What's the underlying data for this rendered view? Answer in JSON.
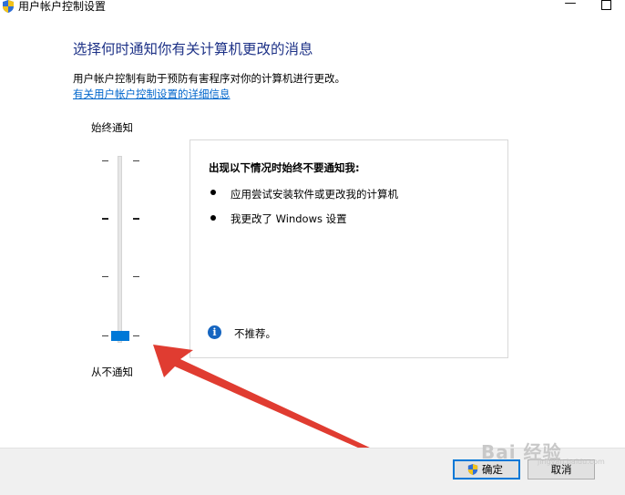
{
  "window": {
    "title": "用户帐户控制设置",
    "minimize_glyph": "—",
    "icon": "uac-shield-icon"
  },
  "main": {
    "heading": "选择何时通知你有关计算机更改的消息",
    "description": "用户帐户控制有助于预防有害程序对你的计算机进行更改。",
    "help_link": "有关用户帐户控制设置的详细信息"
  },
  "slider": {
    "top_label": "始终通知",
    "bottom_label": "从不通知",
    "levels": 4,
    "selected_level": 1,
    "thumb_color": "#0078d7"
  },
  "panel": {
    "heading": "出现以下情况时始终不要通知我:",
    "bullets": [
      "应用尝试安装软件或更改我的计算机",
      "我更改了 Windows 设置"
    ],
    "info_glyph": "i",
    "info_text": "不推荐。"
  },
  "buttons": {
    "ok": "确定",
    "cancel": "取消"
  },
  "annotation": {
    "arrow_color": "#e03c31"
  },
  "watermark": {
    "text": "Bai 经验",
    "sub": "jingyan.baidu.com"
  }
}
